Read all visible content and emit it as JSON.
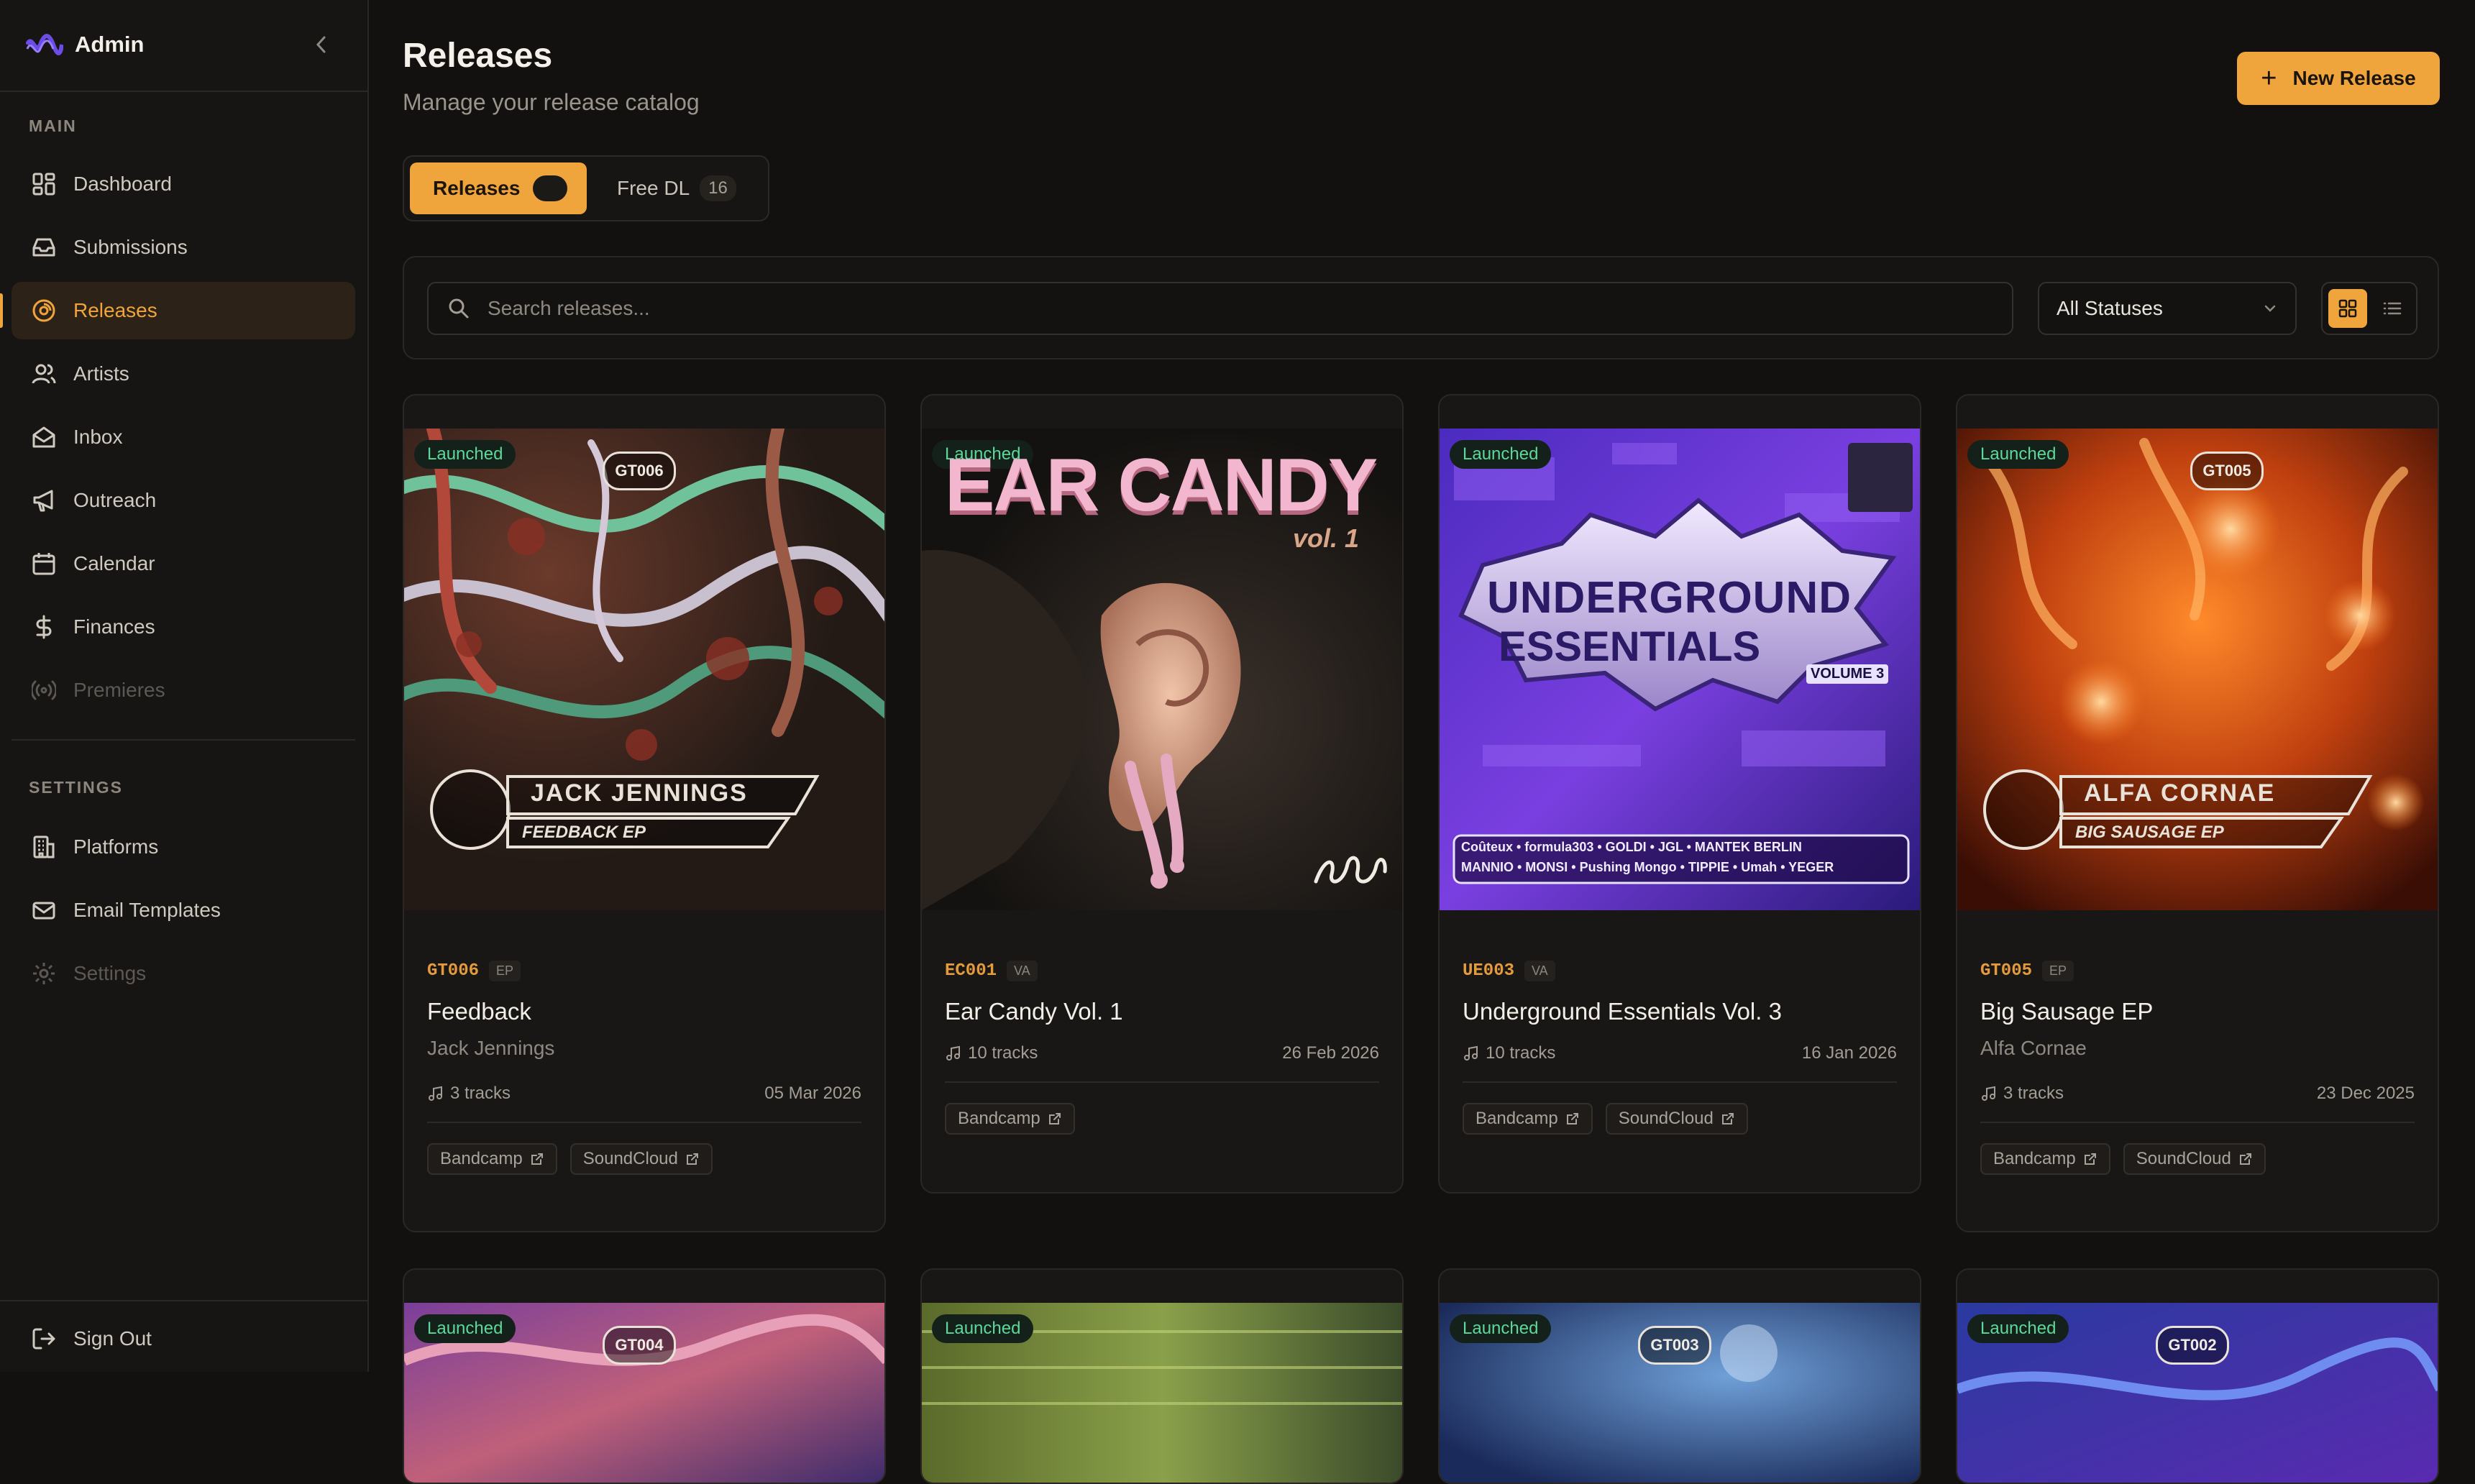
{
  "app": {
    "title": "Admin"
  },
  "sidebar": {
    "main_label": "MAIN",
    "settings_label": "SETTINGS",
    "main_items": [
      {
        "label": "Dashboard",
        "icon": "dashboard-icon"
      },
      {
        "label": "Submissions",
        "icon": "inbox-tray-icon"
      },
      {
        "label": "Releases",
        "icon": "disc-icon",
        "active": true
      },
      {
        "label": "Artists",
        "icon": "users-icon"
      },
      {
        "label": "Inbox",
        "icon": "mail-open-icon"
      },
      {
        "label": "Outreach",
        "icon": "megaphone-icon"
      },
      {
        "label": "Calendar",
        "icon": "calendar-icon"
      },
      {
        "label": "Finances",
        "icon": "dollar-icon"
      },
      {
        "label": "Premieres",
        "icon": "broadcast-icon",
        "disabled": true
      }
    ],
    "settings_items": [
      {
        "label": "Platforms",
        "icon": "building-icon"
      },
      {
        "label": "Email Templates",
        "icon": "envelope-icon"
      },
      {
        "label": "Settings",
        "icon": "gear-icon",
        "disabled": true
      }
    ],
    "sign_out": "Sign Out"
  },
  "header": {
    "title": "Releases",
    "subtitle": "Manage your release catalog",
    "new_release": "New Release"
  },
  "tabs": [
    {
      "label": "Releases",
      "count": ""
    },
    {
      "label": "Free DL",
      "count": "16"
    }
  ],
  "filters": {
    "search_placeholder": "Search releases...",
    "status_value": "All Statuses"
  },
  "colors": {
    "accent": "#f0a43c",
    "launched": "#5fd79a",
    "background": "#121110"
  },
  "releases": [
    {
      "status": "Launched",
      "catalog": "GT006",
      "type": "EP",
      "title": "Feedback",
      "artist": "Jack Jennings",
      "tracks": "3 tracks",
      "date": "05 Mar 2026",
      "links": [
        "Bandcamp",
        "SoundCloud"
      ],
      "cover_logo": "GT006",
      "cover_artist": "JACK JENNINGS",
      "cover_release": "FEEDBACK EP"
    },
    {
      "status": "Launched",
      "catalog": "EC001",
      "type": "VA",
      "title": "Ear Candy Vol. 1",
      "artist": "",
      "tracks": "10 tracks",
      "date": "26 Feb 2026",
      "links": [
        "Bandcamp"
      ],
      "cover_title": "EAR CANDY",
      "cover_vol": "vol. 1"
    },
    {
      "status": "Launched",
      "catalog": "UE003",
      "type": "VA",
      "title": "Underground Essentials Vol. 3",
      "artist": "",
      "tracks": "10 tracks",
      "date": "16 Jan 2026",
      "links": [
        "Bandcamp",
        "SoundCloud"
      ],
      "cover_title_1": "UNDERGROUND",
      "cover_title_2": "ESSENTIALS",
      "cover_vol": "VOLUME 3",
      "cover_line_1": "Coûteux • formula303 • GOLDI • JGL • MANTEK BERLIN",
      "cover_line_2": "MANNIO • MONSI • Pushing Mongo • TIPPIE • Umah • YEGER"
    },
    {
      "status": "Launched",
      "catalog": "GT005",
      "type": "EP",
      "title": "Big Sausage EP",
      "artist": "Alfa Cornae",
      "tracks": "3 tracks",
      "date": "23 Dec 2025",
      "links": [
        "Bandcamp",
        "SoundCloud"
      ],
      "cover_logo": "GT005",
      "cover_artist": "ALFA CORNAE",
      "cover_release": "BIG SAUSAGE EP"
    },
    {
      "status": "Launched",
      "cover_logo": "GT004"
    },
    {
      "status": "Launched"
    },
    {
      "status": "Launched",
      "cover_logo": "GT003"
    },
    {
      "status": "Launched",
      "cover_logo": "GT002"
    }
  ]
}
